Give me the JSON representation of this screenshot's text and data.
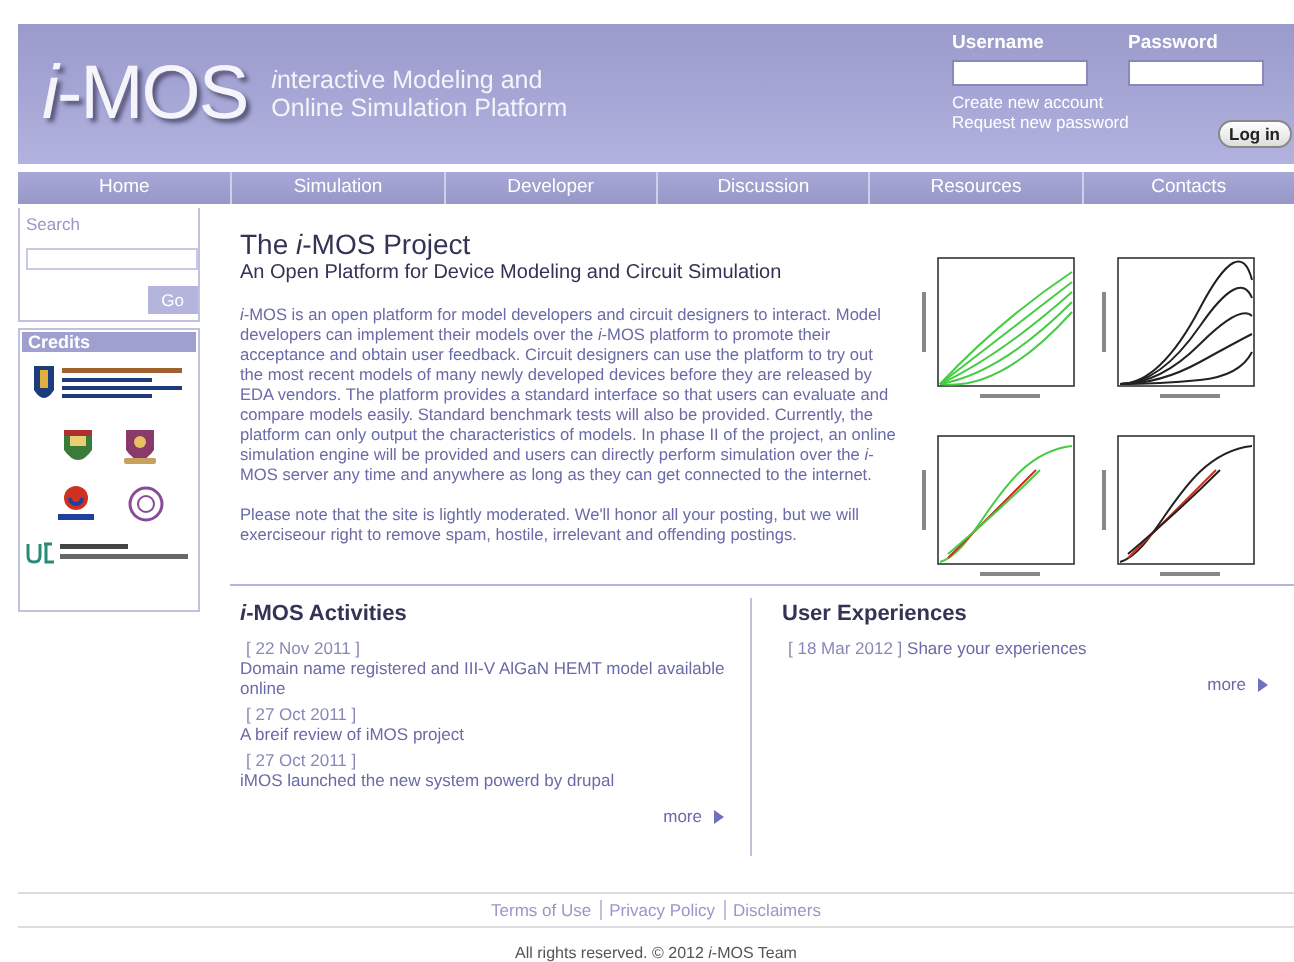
{
  "header": {
    "logo": "*i*-MOS",
    "tagline": [
      {
        "text": "interactive Modeling and",
        "italic_initial": true
      },
      {
        "text": "Online Simulation Platform",
        "italic_initial": false
      }
    ],
    "login": {
      "username_label": "Username",
      "password_label": "Password",
      "links": [
        "Create new account",
        "Request new password"
      ],
      "button": "Log in"
    }
  },
  "nav": {
    "items": [
      {
        "label": "Home"
      },
      {
        "label": "Simulation"
      },
      {
        "label": "Developer"
      },
      {
        "label": "Discussion"
      },
      {
        "label": "Resources"
      },
      {
        "label": "Contacts"
      }
    ]
  },
  "sidebar": {
    "search": {
      "label": "Search",
      "button": "Go"
    },
    "credits": {
      "title": "Credits"
    }
  },
  "project": {
    "title": "The *i*-MOS Project",
    "subtitle": "An Open Platform for Device Modeling and Circuit Simulation",
    "paragraphs": [
      "*i*-MOS is an open platform for model developers and circuit designers to interact. Model developers can implement their models over the *i*-MOS platform to promote their acceptance and obtain user feedback. Circuit designers can use the platform to try out the most recent models of many newly developed devices before they are released by EDA vendors. The platform provides a standard interface so that users can evaluate and compare models easily. Standard benchmark tests will also be provided. Currently, the platform can only output the characteristics of models. In phase II of the project, an online simulation engine will be provided and users can directly perform simulation over the *i*-MOS server any time and anywhere as long as they can get connected to the internet.",
      "Please note that the site is lightly moderated. We'll honor all your posting, but we will exerciseour right to remove spam, hostile, irrelevant and offending postings."
    ]
  },
  "activities": {
    "title": "*i*-MOS Activities",
    "items": [
      {
        "date": "[ 22 Nov 2011 ]",
        "text": "Domain name registered and III-V AlGaN HEMT model available online"
      },
      {
        "date": "[ 27 Oct 2011 ]",
        "text": "A breif review of iMOS project"
      },
      {
        "date": "[ 27 Oct 2011 ]",
        "text": "iMOS launched the new system powerd by drupal"
      }
    ],
    "more": "more"
  },
  "experiences": {
    "title": "User Experiences",
    "items": [
      {
        "date": "[ 18 Mar 2012 ]",
        "text": "Share your experiences"
      }
    ],
    "more": "more"
  },
  "footer": {
    "links": [
      "Terms of Use",
      "Privacy Policy",
      "Disclaimers"
    ],
    "copyright": "All rights reserved. © 2012 *i*-MOS Team"
  }
}
